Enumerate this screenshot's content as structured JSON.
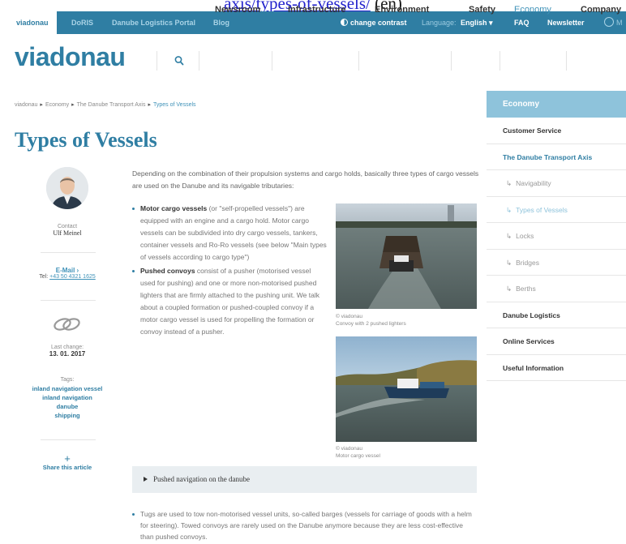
{
  "caption": {
    "link_text": "axis/types-of-vessels/",
    "suffix": " (en)"
  },
  "topbar": {
    "tabs": [
      "viadonau",
      "DoRIS",
      "Danube Logistics Portal",
      "Blog"
    ],
    "change_contrast": "change contrast",
    "language_label": "Language:",
    "language_value": "English",
    "faq": "FAQ",
    "newsletter": "Newsletter",
    "my": "M"
  },
  "header": {
    "logo": "viadonau",
    "nav": [
      "Newsroom",
      "Infrastructure",
      "Environment",
      "Safety",
      "Economy",
      "Company"
    ]
  },
  "breadcrumb": [
    "viadonau",
    "Economy",
    "The Danube Transport Axis",
    "Types of Vessels"
  ],
  "page_title": "Types of Vessels",
  "meta": {
    "contact_label": "Contact",
    "contact_name": "Ulf Meinel",
    "email_link": "E-Mail ›",
    "tel_label": "Tel:",
    "tel_value": "+43 50 4321 1625",
    "last_change_label": "Last change:",
    "last_change_value": "13. 01. 2017",
    "tags_label": "Tags:",
    "tags": [
      "inland navigation vessel",
      "inland navigation",
      "danube",
      "shipping"
    ],
    "share_icon": "+",
    "share_label": "Share this article"
  },
  "content": {
    "intro": "Depending on the combination of their propulsion systems and cargo holds, basically three types of cargo vessels are used on the Danube and its navigable tributaries:",
    "bullet1_bold": "Motor cargo vessels",
    "bullet1_text": " (or \"self-propelled vessels\") are equipped with an engine and a cargo hold. Motor cargo vessels can be subdivided into dry cargo vessels, tankers, container vessels and Ro-Ro vessels (see below \"Main types of vessels according to cargo type\")",
    "bullet2_bold": "Pushed convoys",
    "bullet2_text": " consist of a pusher (motorised vessel used for pushing) and one or more non-motorised pushed lighters that are firmly attached to the pushing unit. We talk about a coupled formation or pushed-coupled convoy if a motor cargo vessel is used for propelling the formation or convoy instead of a pusher.",
    "photo1_credit": "© viadonau",
    "photo1_caption": "Convoy with 2 pushed lighters",
    "photo2_credit": "© viadonau",
    "photo2_caption": "Motor cargo vessel",
    "accordion_label": "Pushed navigation on the danube",
    "tugs_text": "Tugs are used to tow non-motorised vessel units, so-called barges (vessels for carriage of goods with a helm for steering). Towed convoys are rarely used on the Danube anymore because they are less cost-effective than pushed convoys."
  },
  "sidebar": {
    "heading": "Economy",
    "items": [
      {
        "label": "Customer Service"
      },
      {
        "label": "The Danube Transport Axis"
      },
      {
        "label": "Navigability"
      },
      {
        "label": "Types of Vessels"
      },
      {
        "label": "Locks"
      },
      {
        "label": "Bridges"
      },
      {
        "label": "Berths"
      },
      {
        "label": "Danube Logistics"
      },
      {
        "label": "Online Services"
      },
      {
        "label": "Useful Information"
      }
    ]
  },
  "colors": {
    "brand": "#2f7ea3",
    "sidebar_head": "#8ec3db",
    "link": "#3f92b8"
  }
}
